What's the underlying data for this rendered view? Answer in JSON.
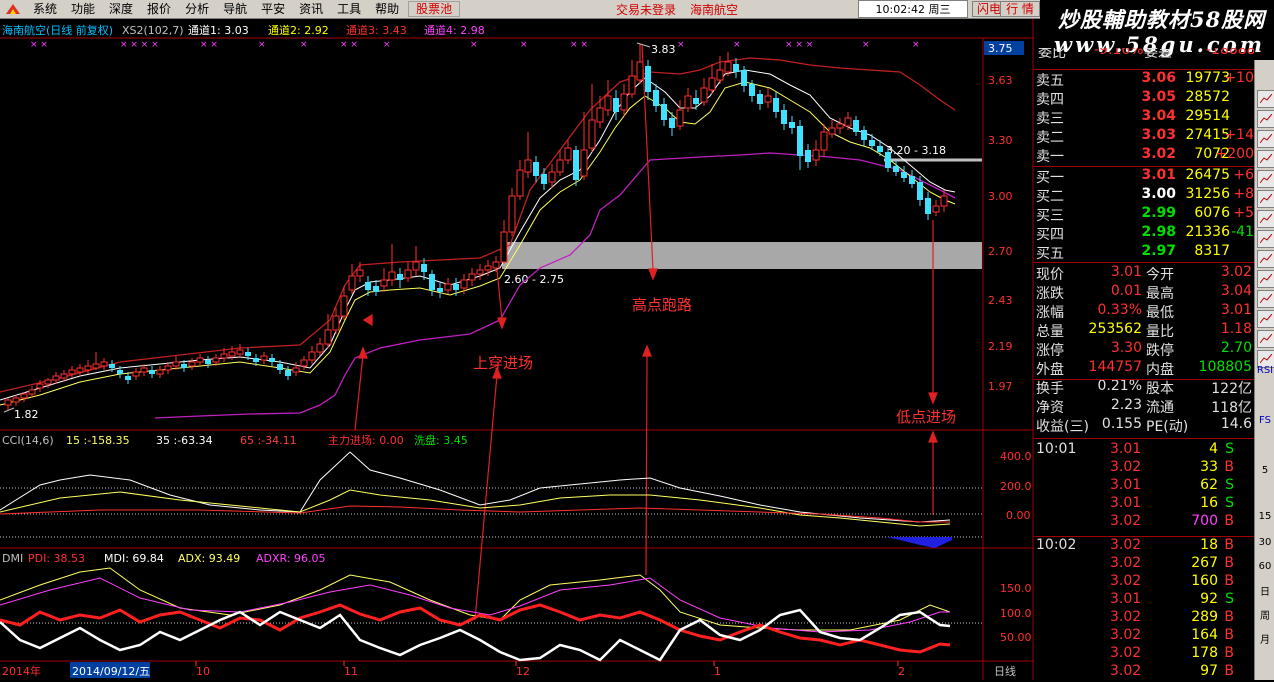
{
  "menu": {
    "items": [
      "系统",
      "功能",
      "深度",
      "报价",
      "分析",
      "导航",
      "平安",
      "资讯",
      "工具",
      "帮助"
    ],
    "highlight": "股票池",
    "status": "交易未登录",
    "stock": "海南航空",
    "clock": "10:02:42 周三",
    "btn_flash": "闪电手",
    "btn_quote": "行 情"
  },
  "watermark": {
    "line1": "炒股輔助教材58股网",
    "line2": "www.58gu.com"
  },
  "main_chart": {
    "title": "海南航空(日线 前复权)",
    "indicator": "XS2(102,7)",
    "ch1": "通道1: 3.03",
    "ch2": "通道2: 2.92",
    "ch3": "通道3: 3.43",
    "ch4": "通道4: 2.98",
    "price_axis": [
      "3.75",
      "3.63",
      "3.30",
      "3.00",
      "2.70",
      "2.43",
      "2.19",
      "1.97"
    ],
    "low_label": "1.82",
    "high_label": "3.83",
    "zone1": "2.60 - 2.75",
    "zone2": "3.20 - 3.18",
    "annotations": {
      "buy1": "上穿进场",
      "sell": "高点跑路",
      "buy2": "低点进场"
    }
  },
  "cci": {
    "name": "CCI(14,6)",
    "v15": "15 :-158.35",
    "v35": "35 :-63.34",
    "v65": "65 :-34.11",
    "main": "主力进场: 0.00",
    "wash": "洗盘: 3.45",
    "axis": [
      "400.0",
      "200.0",
      "0.00"
    ]
  },
  "dmi": {
    "name": "DMI",
    "pdi": "PDI: 38.53",
    "mdi": "MDI: 69.84",
    "adx": "ADX: 93.49",
    "adxr": "ADXR: 96.05",
    "axis": [
      "150.0",
      "100.0",
      "50.00"
    ]
  },
  "time_axis": {
    "year": "2014年",
    "cursor": "2014/09/12/五",
    "months": [
      "10",
      "11",
      "12",
      "1",
      "2"
    ],
    "period": "日线"
  },
  "quote": {
    "weibi": {
      "label": "委比",
      "value": "-9.16%",
      "label2": "委差",
      "value2": "-18888"
    },
    "asks": [
      {
        "label": "卖五",
        "price": "3.06",
        "vol": "19773",
        "chg": "+10"
      },
      {
        "label": "卖四",
        "price": "3.05",
        "vol": "28572",
        "chg": ""
      },
      {
        "label": "卖三",
        "price": "3.04",
        "vol": "29514",
        "chg": ""
      },
      {
        "label": "卖二",
        "price": "3.03",
        "vol": "27415",
        "chg": "+14"
      },
      {
        "label": "卖一",
        "price": "3.02",
        "vol": "7072",
        "chg": "+200"
      }
    ],
    "bids": [
      {
        "label": "买一",
        "price": "3.01",
        "vol": "26475",
        "chg": "+6"
      },
      {
        "label": "买二",
        "price": "3.00",
        "vol": "31256",
        "chg": "+8"
      },
      {
        "label": "买三",
        "price": "2.99",
        "vol": "6076",
        "chg": "+5"
      },
      {
        "label": "买四",
        "price": "2.98",
        "vol": "21336",
        "chg": "-41"
      },
      {
        "label": "买五",
        "price": "2.97",
        "vol": "8317",
        "chg": ""
      }
    ],
    "stats": [
      {
        "l1": "现价",
        "v1": "3.01",
        "l2": "今开",
        "v2": "3.02",
        "c1": "#ff3030",
        "c2": "#ff3030"
      },
      {
        "l1": "涨跌",
        "v1": "0.01",
        "l2": "最高",
        "v2": "3.04",
        "c1": "#ff3030",
        "c2": "#ff3030"
      },
      {
        "l1": "涨幅",
        "v1": "0.33%",
        "l2": "最低",
        "v2": "3.01",
        "c1": "#ff3030",
        "c2": "#ff3030"
      },
      {
        "l1": "总量",
        "v1": "253562",
        "l2": "量比",
        "v2": "1.18",
        "c1": "#ffff00",
        "c2": "#ff3030"
      },
      {
        "l1": "涨停",
        "v1": "3.30",
        "l2": "跌停",
        "v2": "2.70",
        "c1": "#ff3030",
        "c2": "#00e000"
      },
      {
        "l1": "外盘",
        "v1": "144757",
        "l2": "内盘",
        "v2": "108805",
        "c1": "#ff3030",
        "c2": "#00e000"
      },
      {
        "l1": "换手",
        "v1": "0.21%",
        "l2": "股本",
        "v2": "122亿",
        "c1": "#e0e0e0",
        "c2": "#e0e0e0"
      },
      {
        "l1": "净资",
        "v1": "2.23",
        "l2": "流通",
        "v2": "118亿",
        "c1": "#e0e0e0",
        "c2": "#e0e0e0"
      },
      {
        "l1": "收益(三)",
        "v1": "0.155",
        "l2": "PE(动)",
        "v2": "14.6",
        "c1": "#e0e0e0",
        "c2": "#e0e0e0"
      }
    ],
    "ticks": [
      {
        "time": "10:01",
        "price": "3.01",
        "vol": "4",
        "bs": "S"
      },
      {
        "time": "",
        "price": "3.02",
        "vol": "33",
        "bs": "B"
      },
      {
        "time": "",
        "price": "3.01",
        "vol": "62",
        "bs": "S"
      },
      {
        "time": "",
        "price": "3.01",
        "vol": "16",
        "bs": "S"
      },
      {
        "time": "",
        "price": "3.02",
        "vol": "700",
        "bs": "B"
      },
      {
        "time": "10:02",
        "price": "3.02",
        "vol": "18",
        "bs": "B"
      },
      {
        "time": "",
        "price": "3.02",
        "vol": "267",
        "bs": "B"
      },
      {
        "time": "",
        "price": "3.02",
        "vol": "160",
        "bs": "B"
      },
      {
        "time": "",
        "price": "3.01",
        "vol": "92",
        "bs": "S"
      },
      {
        "time": "",
        "price": "3.02",
        "vol": "289",
        "bs": "B"
      },
      {
        "time": "",
        "price": "3.02",
        "vol": "164",
        "bs": "B"
      },
      {
        "time": "",
        "price": "3.02",
        "vol": "178",
        "bs": "B"
      },
      {
        "time": "",
        "price": "3.02",
        "vol": "97",
        "bs": "B"
      }
    ]
  },
  "sidebar": {
    "labels": [
      "RSI",
      "FS",
      "5",
      "15",
      "30",
      "60",
      "日",
      "周",
      "月"
    ]
  }
}
